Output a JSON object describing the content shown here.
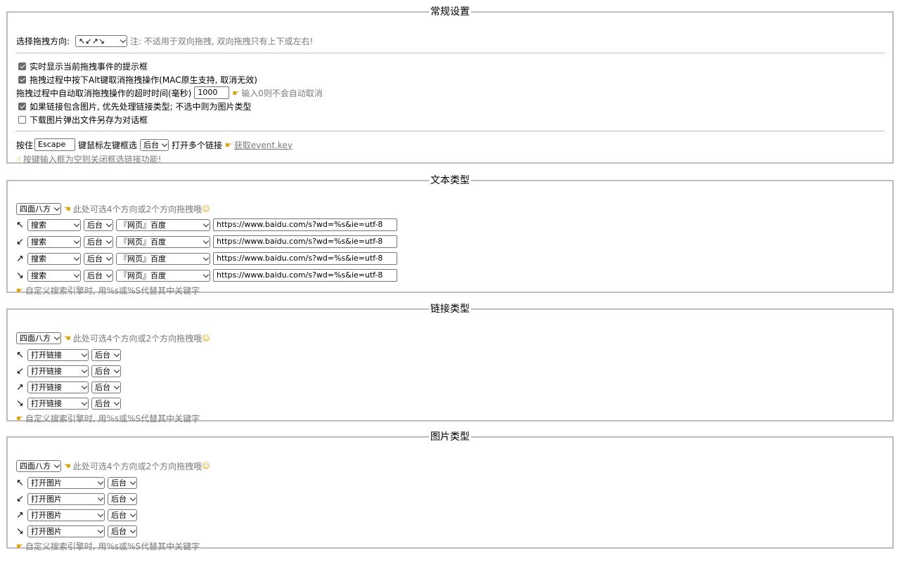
{
  "general": {
    "legend": "常规设置",
    "direction_label": "选择拖拽方向:",
    "direction_value": "↖↙↗↘",
    "direction_note": "注: 不适用于双向拖拽, 双向拖拽只有上下或左右!",
    "opt_show_tip": "实时显示当前拖拽事件的提示框",
    "opt_alt_cancel": "拖拽过程中按下Alt键取消拖拽操作(MAC原生支持, 取消无效)",
    "timeout_label": "拖拽过程中自动取消拖拽操作的超时时间(毫秒)",
    "timeout_value": "1000",
    "timeout_note": "输入0则不会自动取消",
    "opt_link_image": "如果链接包含图片, 优先处理链接类型; 不选中则为图片类型",
    "opt_download_dialog": "下载图片弹出文件另存为对话框",
    "hold_label": "按住",
    "hold_key_value": "Escape",
    "hold_mid": "键鼠标左键框选",
    "hold_target": "后台",
    "hold_suffix": "打开多个链接",
    "get_key_link": "获取event.key",
    "hold_note": "按键输入框为空则关闭框选链接功能!"
  },
  "text_type": {
    "legend": "文本类型",
    "mode_value": "四面八方",
    "mode_note": "此处可选4个方向或2个方向拖拽哦",
    "rows": [
      {
        "arrow": "↖",
        "action": "搜索",
        "target": "后台",
        "engine": "『网页』百度",
        "url": "https://www.baidu.com/s?wd=%s&ie=utf-8"
      },
      {
        "arrow": "↙",
        "action": "搜索",
        "target": "后台",
        "engine": "『网页』百度",
        "url": "https://www.baidu.com/s?wd=%s&ie=utf-8"
      },
      {
        "arrow": "↗",
        "action": "搜索",
        "target": "后台",
        "engine": "『网页』百度",
        "url": "https://www.baidu.com/s?wd=%s&ie=utf-8"
      },
      {
        "arrow": "↘",
        "action": "搜索",
        "target": "后台",
        "engine": "『网页』百度",
        "url": "https://www.baidu.com/s?wd=%s&ie=utf-8"
      }
    ],
    "footer_note": "自定义搜索引擎时, 用%s或%S代替其中关键字"
  },
  "link_type": {
    "legend": "链接类型",
    "mode_value": "四面八方",
    "mode_note": "此处可选4个方向或2个方向拖拽哦",
    "rows": [
      {
        "arrow": "↖",
        "action": "打开链接",
        "target": "后台"
      },
      {
        "arrow": "↙",
        "action": "打开链接",
        "target": "后台"
      },
      {
        "arrow": "↗",
        "action": "打开链接",
        "target": "后台"
      },
      {
        "arrow": "↘",
        "action": "打开链接",
        "target": "后台"
      }
    ],
    "footer_note": "自定义搜索引擎时, 用%s或%S代替其中关键字"
  },
  "image_type": {
    "legend": "图片类型",
    "mode_value": "四面八方",
    "mode_note": "此处可选4个方向或2个方向拖拽哦",
    "rows": [
      {
        "arrow": "↖",
        "action": "打开图片",
        "target": "后台"
      },
      {
        "arrow": "↙",
        "action": "打开图片",
        "target": "后台"
      },
      {
        "arrow": "↗",
        "action": "打开图片",
        "target": "后台"
      },
      {
        "arrow": "↘",
        "action": "打开图片",
        "target": "后台"
      }
    ],
    "footer_note": "自定义搜索引擎时, 用%s或%S代替其中关键字"
  },
  "colors": {
    "hint": "#e0a000",
    "gray_text": "#7a7a7a",
    "border": "#bdbdbd"
  },
  "icons": {
    "hint": "pointing-hand-icon",
    "smile": "smile-emoji-icon",
    "check": "checkbox-icon"
  }
}
